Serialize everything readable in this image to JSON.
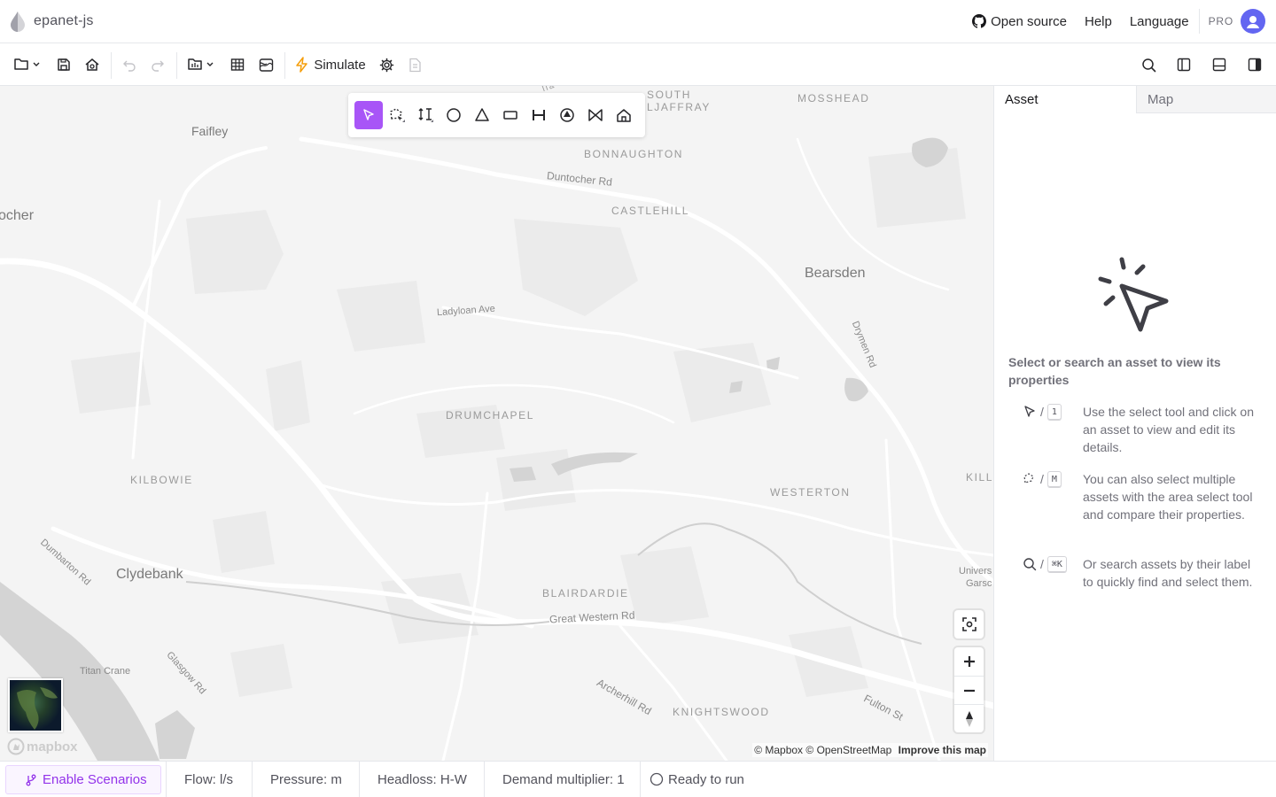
{
  "app": {
    "title": "epanet-js"
  },
  "header": {
    "links": {
      "open_source": "Open source",
      "help": "Help",
      "language": "Language"
    },
    "plan_badge": "PRO"
  },
  "toolbar": {
    "simulate_label": "Simulate",
    "icons": [
      "folder-icon",
      "save-icon",
      "save-as-icon",
      "undo-icon",
      "redo-icon",
      "import-icon",
      "table-icon",
      "map-layers-icon",
      "simulate-icon",
      "settings-icon",
      "report-icon",
      "search-icon",
      "left-panel-icon",
      "bottom-panel-icon",
      "right-panel-icon"
    ]
  },
  "draw_tools": [
    "select-tool",
    "area-select-tool",
    "move-tool",
    "junction-tool",
    "reservoir-tool",
    "tank-tool",
    "pipe-tool",
    "pump-tool",
    "valve-tool",
    "customer-point-tool"
  ],
  "map": {
    "labels": {
      "faifley": "Faifley",
      "ocher": "ocher",
      "south_ljaffray": "SOUTH\nLJAFFRAY",
      "mosshead": "MOSSHEAD",
      "bonnaughton": "BONNAUGHTON",
      "duntocher_rd": "Duntocher Rd",
      "castlehill": "CASTLEHILL",
      "bearsden": "Bearsden",
      "ladyloan_ave": "Ladyloan Ave",
      "drymen_rd": "Drymen Rd",
      "drumchapel": "DRUMCHAPEL",
      "kilbowie": "KILBOWIE",
      "westerton": "WESTERTON",
      "kill": "KILL",
      "dumbarton_rd": "Dumbarton Rd",
      "clydebank": "Clydebank",
      "blairdardie": "BLAIRDARDIE",
      "great_western_rd": "Great Western Rd",
      "univers": "Univers",
      "garsc": "Garsc",
      "titan_crane": "Titan Crane",
      "glasgow_rd": "Glasgow Rd",
      "archerhill_rd": "Archerhill Rd",
      "knightswood": "KNIGHTSWOOD",
      "fulton_st": "Fulton St",
      "lia": "lia"
    },
    "attribution": {
      "mapbox": "© Mapbox",
      "osm": "© OpenStreetMap",
      "improve": "Improve this map"
    },
    "mapbox_logo": "mapbox"
  },
  "panel": {
    "tabs": {
      "asset": "Asset",
      "map": "Map"
    },
    "empty_title": "Select or search an asset to view its properties",
    "hints": [
      {
        "key": "1",
        "text": "Use the select tool and click on an asset to view and edit its details."
      },
      {
        "key": "M",
        "text": "You can also select multiple assets with the area select tool and compare their properties."
      },
      {
        "key": "⌘K",
        "text": "Or search assets by their label to quickly find and select them."
      }
    ],
    "hint_sep": "/"
  },
  "status": {
    "scenarios": "Enable Scenarios",
    "flow": "Flow: l/s",
    "pressure": "Pressure: m",
    "headloss": "Headloss: H-W",
    "demand": "Demand multiplier: 1",
    "run_state": "Ready to run"
  },
  "colors": {
    "accent": "#a855f7",
    "scenario_text": "#9333ea",
    "avatar": "#6366f1"
  }
}
